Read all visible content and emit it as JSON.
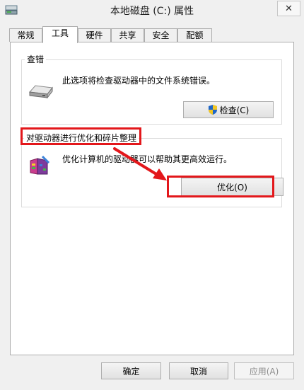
{
  "window": {
    "title": "本地磁盘 (C:) 属性",
    "close_label": "✕"
  },
  "tabs": [
    {
      "label": "常规"
    },
    {
      "label": "工具"
    },
    {
      "label": "硬件"
    },
    {
      "label": "共享"
    },
    {
      "label": "安全"
    },
    {
      "label": "配额"
    }
  ],
  "check_group": {
    "title": "查错",
    "description": "此选项将检查驱动器中的文件系统错误。",
    "button_label": "检查(C)"
  },
  "optimize_group": {
    "title": "对驱动器进行优化和碎片整理",
    "description": "优化计算机的驱动器可以帮助其更高效运行。",
    "button_label": "优化(O)"
  },
  "footer": {
    "ok_label": "确定",
    "cancel_label": "取消",
    "apply_label": "应用(A)"
  },
  "annotation_color": "#e3171b",
  "icons": [
    "drive-icon",
    "close-icon",
    "hard-disk-icon",
    "shield-icon",
    "defrag-icon",
    "red-arrow"
  ]
}
